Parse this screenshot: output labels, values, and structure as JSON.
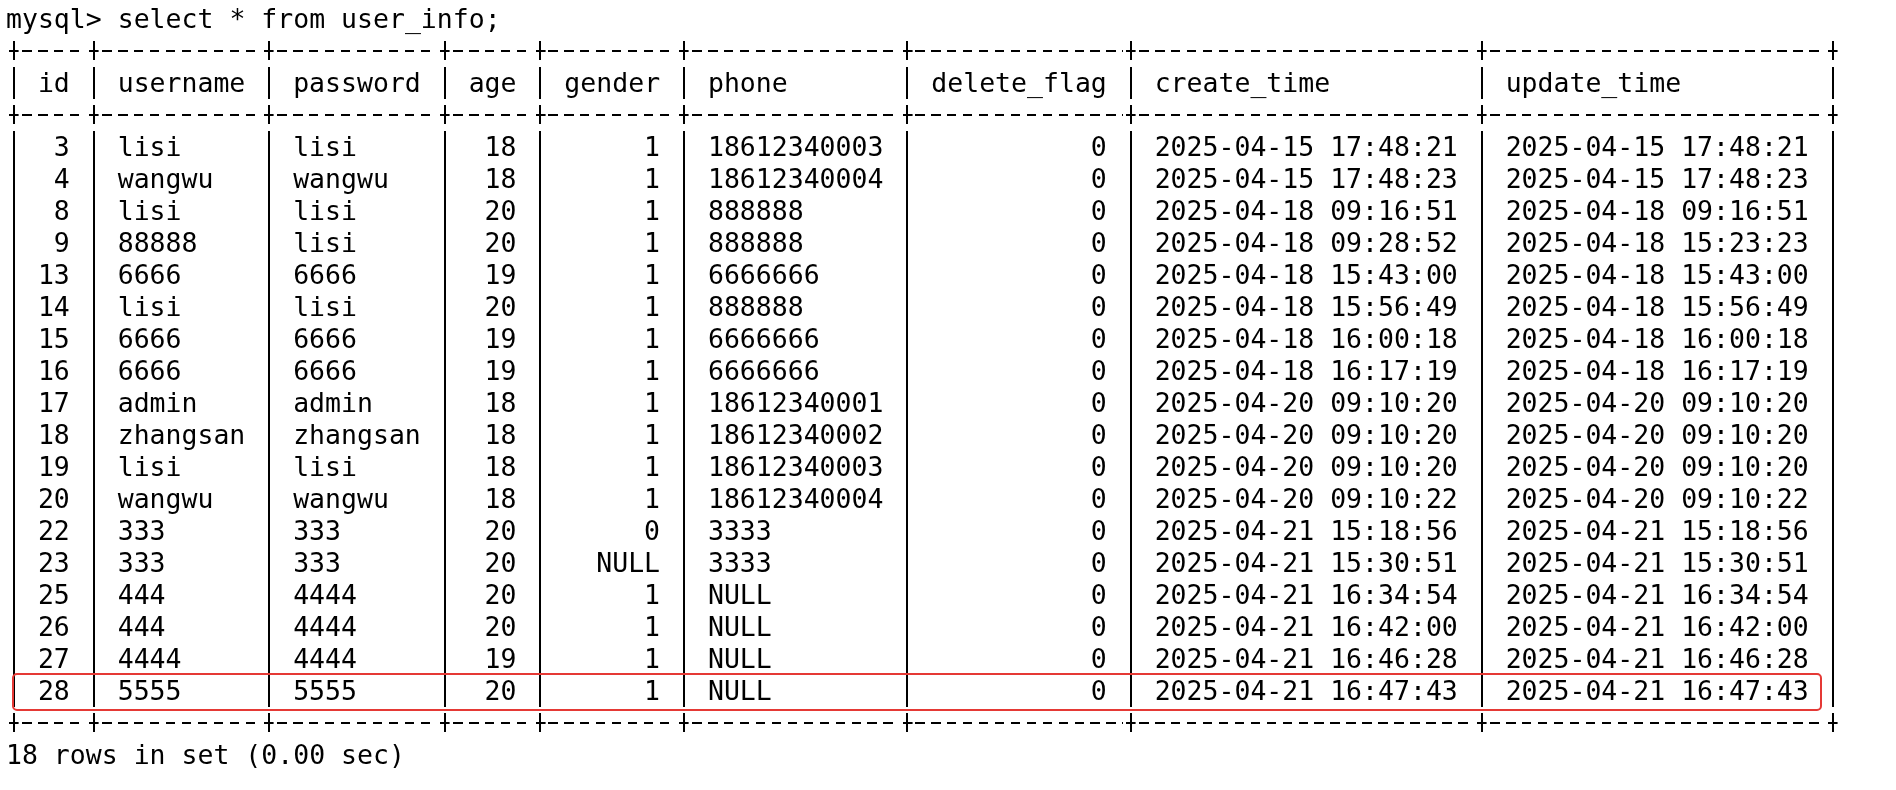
{
  "terminal": {
    "prompt": "mysql>",
    "command": "select * from user_info;",
    "table": {
      "columns": [
        {
          "label": "id",
          "numeric": true
        },
        {
          "label": "username",
          "numeric": false
        },
        {
          "label": "password",
          "numeric": false
        },
        {
          "label": "age",
          "numeric": true
        },
        {
          "label": "gender",
          "numeric": true
        },
        {
          "label": "phone",
          "numeric": false
        },
        {
          "label": "delete_flag",
          "numeric": true
        },
        {
          "label": "create_time",
          "numeric": false
        },
        {
          "label": "update_time",
          "numeric": false
        }
      ],
      "rows": [
        {
          "cells": [
            "3",
            "lisi",
            "lisi",
            "18",
            "1",
            "18612340003",
            "0",
            "2025-04-15 17:48:21",
            "2025-04-15 17:48:21"
          ],
          "highlighted": false
        },
        {
          "cells": [
            "4",
            "wangwu",
            "wangwu",
            "18",
            "1",
            "18612340004",
            "0",
            "2025-04-15 17:48:23",
            "2025-04-15 17:48:23"
          ],
          "highlighted": false
        },
        {
          "cells": [
            "8",
            "lisi",
            "lisi",
            "20",
            "1",
            "888888",
            "0",
            "2025-04-18 09:16:51",
            "2025-04-18 09:16:51"
          ],
          "highlighted": false
        },
        {
          "cells": [
            "9",
            "88888",
            "lisi",
            "20",
            "1",
            "888888",
            "0",
            "2025-04-18 09:28:52",
            "2025-04-18 15:23:23"
          ],
          "highlighted": false
        },
        {
          "cells": [
            "13",
            "6666",
            "6666",
            "19",
            "1",
            "6666666",
            "0",
            "2025-04-18 15:43:00",
            "2025-04-18 15:43:00"
          ],
          "highlighted": false
        },
        {
          "cells": [
            "14",
            "lisi",
            "lisi",
            "20",
            "1",
            "888888",
            "0",
            "2025-04-18 15:56:49",
            "2025-04-18 15:56:49"
          ],
          "highlighted": false
        },
        {
          "cells": [
            "15",
            "6666",
            "6666",
            "19",
            "1",
            "6666666",
            "0",
            "2025-04-18 16:00:18",
            "2025-04-18 16:00:18"
          ],
          "highlighted": false
        },
        {
          "cells": [
            "16",
            "6666",
            "6666",
            "19",
            "1",
            "6666666",
            "0",
            "2025-04-18 16:17:19",
            "2025-04-18 16:17:19"
          ],
          "highlighted": false
        },
        {
          "cells": [
            "17",
            "admin",
            "admin",
            "18",
            "1",
            "18612340001",
            "0",
            "2025-04-20 09:10:20",
            "2025-04-20 09:10:20"
          ],
          "highlighted": false
        },
        {
          "cells": [
            "18",
            "zhangsan",
            "zhangsan",
            "18",
            "1",
            "18612340002",
            "0",
            "2025-04-20 09:10:20",
            "2025-04-20 09:10:20"
          ],
          "highlighted": false
        },
        {
          "cells": [
            "19",
            "lisi",
            "lisi",
            "18",
            "1",
            "18612340003",
            "0",
            "2025-04-20 09:10:20",
            "2025-04-20 09:10:20"
          ],
          "highlighted": false
        },
        {
          "cells": [
            "20",
            "wangwu",
            "wangwu",
            "18",
            "1",
            "18612340004",
            "0",
            "2025-04-20 09:10:22",
            "2025-04-20 09:10:22"
          ],
          "highlighted": false
        },
        {
          "cells": [
            "22",
            "333",
            "333",
            "20",
            "0",
            "3333",
            "0",
            "2025-04-21 15:18:56",
            "2025-04-21 15:18:56"
          ],
          "highlighted": false
        },
        {
          "cells": [
            "23",
            "333",
            "333",
            "20",
            "NULL",
            "3333",
            "0",
            "2025-04-21 15:30:51",
            "2025-04-21 15:30:51"
          ],
          "highlighted": false
        },
        {
          "cells": [
            "25",
            "444",
            "4444",
            "20",
            "1",
            "NULL",
            "0",
            "2025-04-21 16:34:54",
            "2025-04-21 16:34:54"
          ],
          "highlighted": false
        },
        {
          "cells": [
            "26",
            "444",
            "4444",
            "20",
            "1",
            "NULL",
            "0",
            "2025-04-21 16:42:00",
            "2025-04-21 16:42:00"
          ],
          "highlighted": false
        },
        {
          "cells": [
            "27",
            "4444",
            "4444",
            "19",
            "1",
            "NULL",
            "0",
            "2025-04-21 16:46:28",
            "2025-04-21 16:46:28"
          ],
          "highlighted": false
        },
        {
          "cells": [
            "28",
            "5555",
            "5555",
            "20",
            "1",
            "NULL",
            "0",
            "2025-04-21 16:47:43",
            "2025-04-21 16:47:43"
          ],
          "highlighted": true
        }
      ]
    },
    "result": "18 rows in set (0.00 sec)"
  }
}
